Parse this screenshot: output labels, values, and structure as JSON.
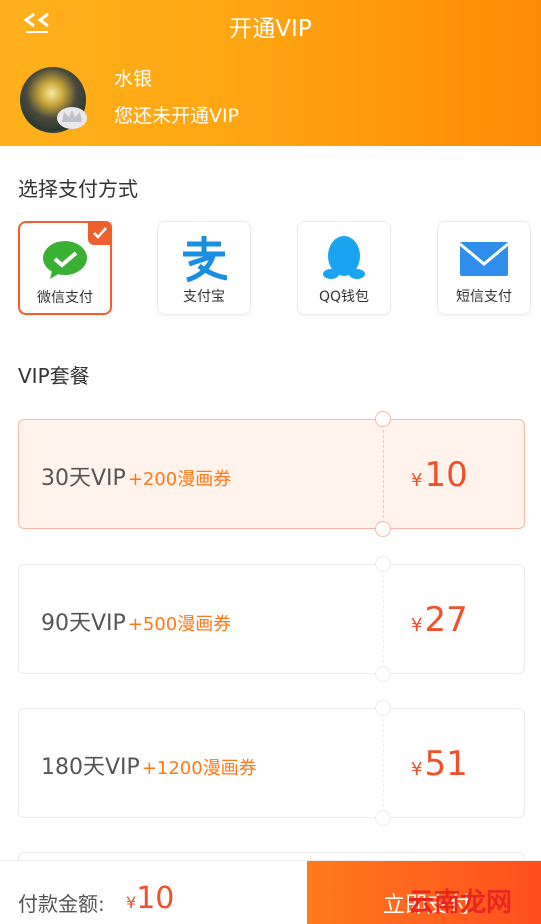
{
  "header": {
    "title": "开通VIP"
  },
  "user": {
    "name": "水银",
    "status": "您还未开通VIP"
  },
  "payment": {
    "section_title": "选择支付方式",
    "methods": [
      {
        "label": "微信支付",
        "icon": "wechat-icon",
        "selected": true
      },
      {
        "label": "支付宝",
        "icon": "alipay-icon"
      },
      {
        "label": "QQ钱包",
        "icon": "qq-icon"
      },
      {
        "label": "短信支付",
        "icon": "sms-icon"
      }
    ]
  },
  "vip": {
    "section_title": "VIP套餐",
    "packages": [
      {
        "name": "30天VIP",
        "bonus": "+200漫画券",
        "currency": "¥",
        "price": "10",
        "selected": true
      },
      {
        "name": "90天VIP",
        "bonus": "+500漫画券",
        "currency": "¥",
        "price": "27"
      },
      {
        "name": "180天VIP",
        "bonus": "+1200漫画券",
        "currency": "¥",
        "price": "51"
      }
    ]
  },
  "footer": {
    "amount_label": "付款金额:",
    "currency": "¥",
    "amount": "10",
    "buy_label": "立即支付"
  },
  "watermark": "云南龙网",
  "colors": {
    "accent": "#ff9a0e",
    "price": "#f0502a",
    "bonus": "#ff7a1a"
  }
}
